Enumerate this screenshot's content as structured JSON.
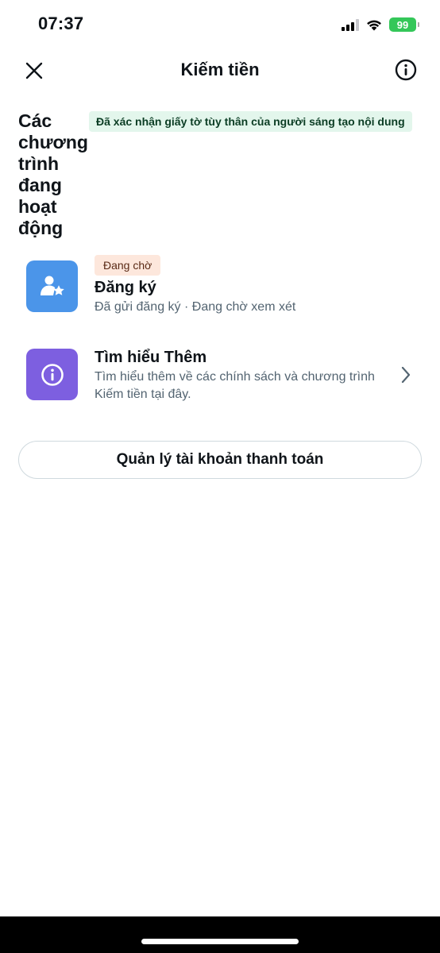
{
  "status_bar": {
    "time": "07:37",
    "battery": "99",
    "icons": [
      "signal-icon",
      "wifi-icon",
      "battery-icon"
    ]
  },
  "header": {
    "title": "Kiếm tiền",
    "close_icon": "close-icon",
    "info_icon": "info-icon"
  },
  "section": {
    "title": "Các chương trình đang hoạt động",
    "verified_badge": "Đã xác nhận giấy tờ tùy thân của người sáng tạo nội dung"
  },
  "programs": [
    {
      "badge": "Đang chờ",
      "name": "Đăng ký",
      "subtitle": "Đã gửi đăng ký · Đang chờ xem xét",
      "icon": "person-star-icon",
      "icon_color": "#4b95e9"
    },
    {
      "name": "Tìm hiểu Thêm",
      "subtitle": "Tìm hiểu thêm về các chính sách và chương trình Kiếm tiền tại đây.",
      "icon": "info-icon",
      "icon_color": "#7d5fe0"
    }
  ],
  "manage_button": {
    "label": "Quản lý tài khoản thanh toán"
  },
  "colors": {
    "verified_bg": "#e3f6ec",
    "pending_bg": "#fde7dc",
    "battery": "#34c759"
  }
}
